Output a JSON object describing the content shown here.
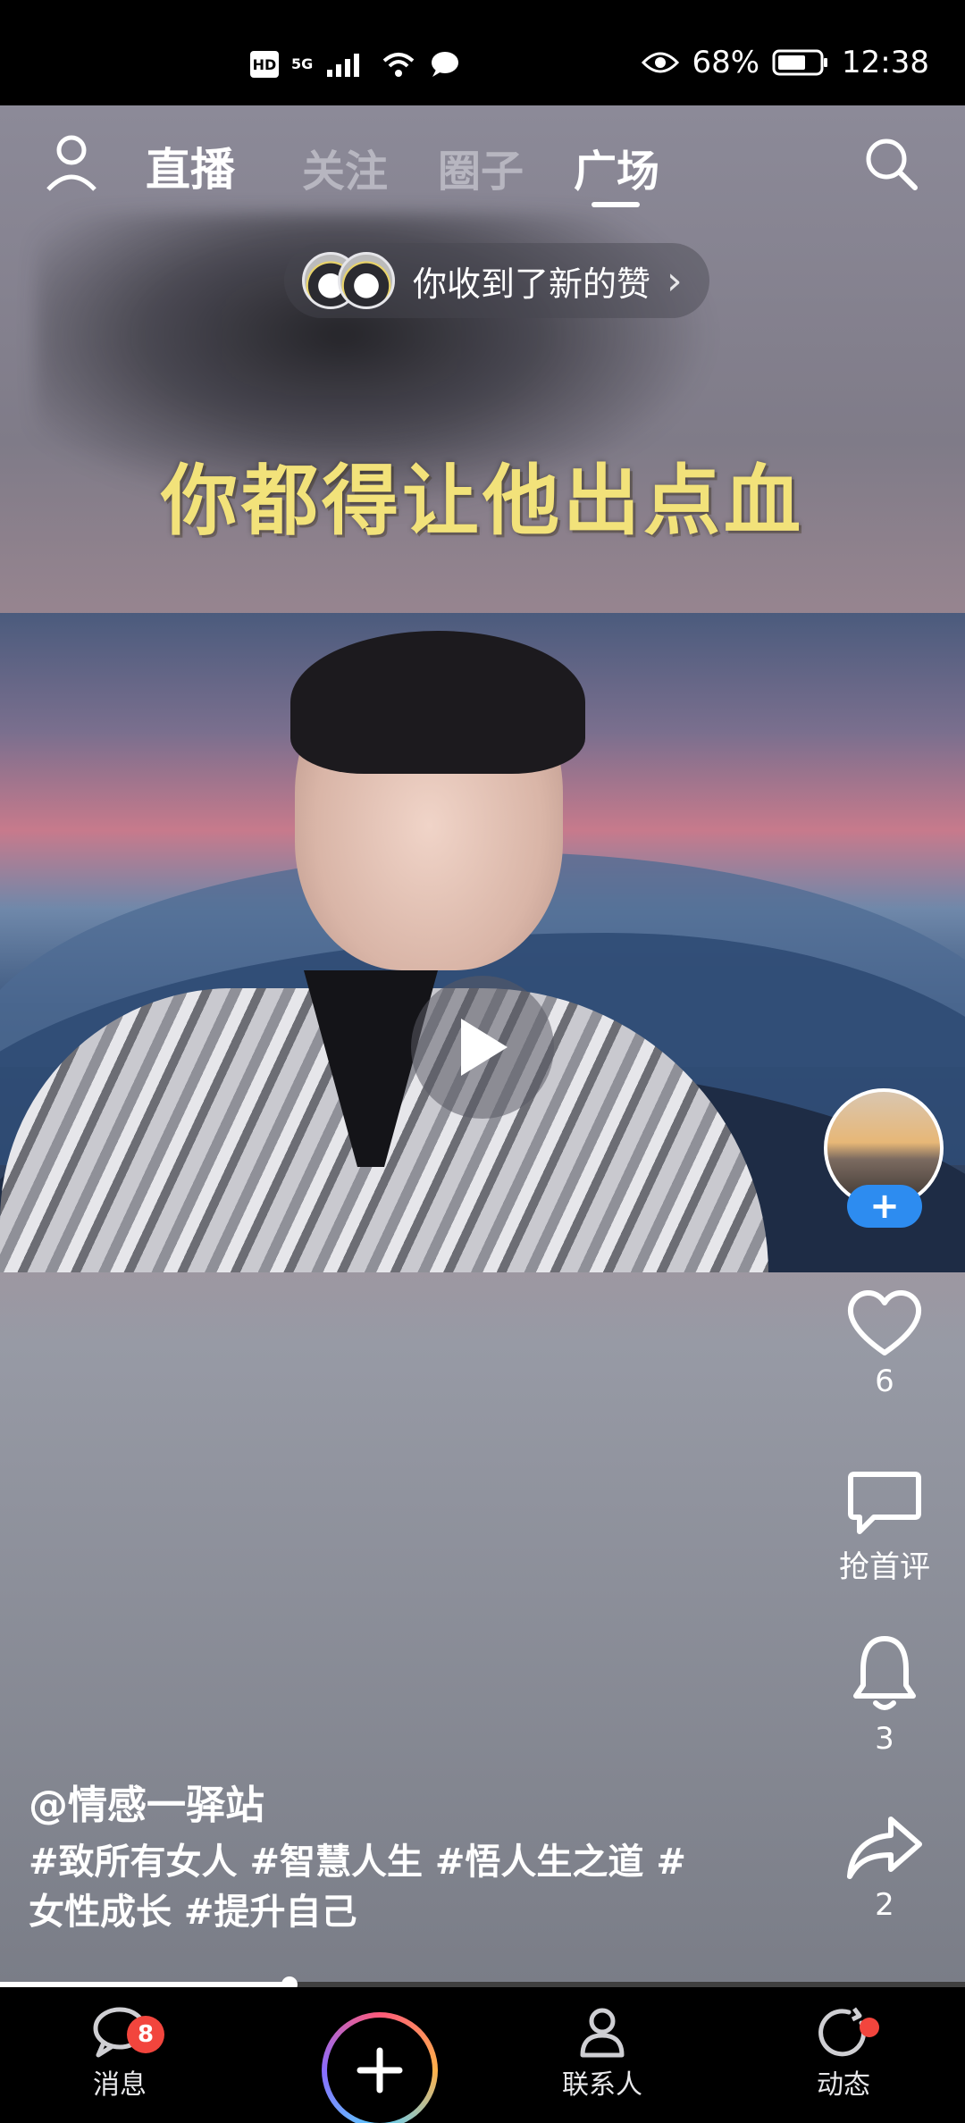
{
  "status_bar": {
    "left_badges": [
      "HD",
      "5G"
    ],
    "battery": "68%",
    "time": "12:38"
  },
  "top_nav": {
    "live_label": "直播",
    "tabs": [
      {
        "label": "关注",
        "active": false
      },
      {
        "label": "圈子",
        "active": false
      },
      {
        "label": "广场",
        "active": true
      }
    ]
  },
  "notice": {
    "text": "你收到了新的赞",
    "chevron": "›"
  },
  "video": {
    "subtitle": "你都得让他出点血",
    "progress": 0.3
  },
  "actions": {
    "follow_symbol": "+",
    "like_count": "6",
    "comment_label": "抢首评",
    "bell_count": "3",
    "share_count": "2"
  },
  "caption": {
    "author": "@情感一驿站",
    "tags": "#致所有女人 #智慧人生 #悟人生之道 #女性成长 #提升自己"
  },
  "bottom_bar": {
    "messages_label": "消息",
    "messages_badge": "8",
    "contacts_label": "联系人",
    "moments_label": "动态"
  },
  "colors": {
    "subtitle": "#f2e27a",
    "follow_button": "#2d8cf0",
    "badge": "#f2453d"
  }
}
